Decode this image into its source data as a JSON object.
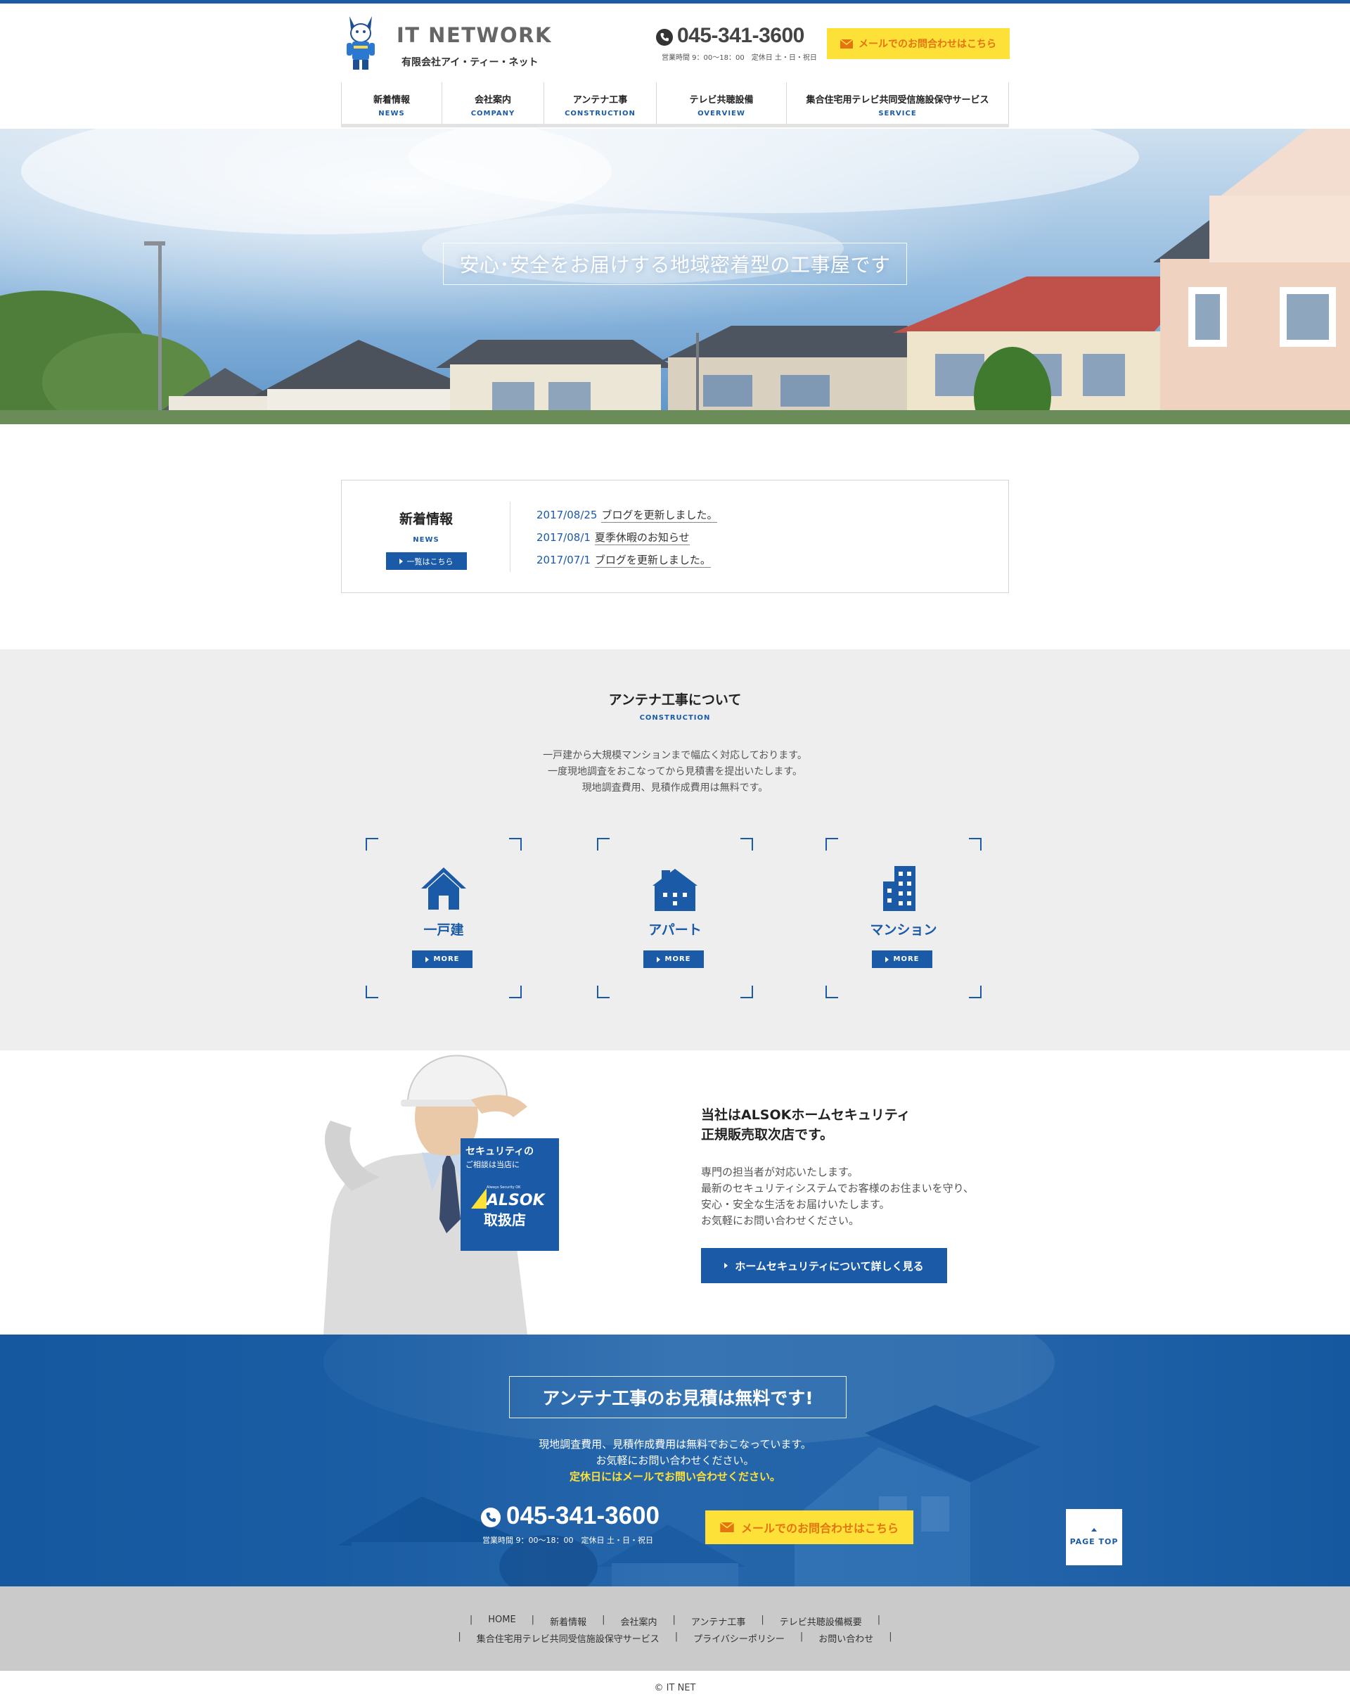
{
  "header": {
    "logo_title": "IT NETWORK",
    "logo_sub": "有限会社アイ・ティー・ネット",
    "tel": "045-341-3600",
    "hours": "営業時間 9：00〜18：00　定休日 土・日・祝日",
    "mail_label": "メールでのお問合わせはこちら"
  },
  "nav": [
    {
      "ja": "新着情報",
      "en": "NEWS"
    },
    {
      "ja": "会社案内",
      "en": "COMPANY"
    },
    {
      "ja": "アンテナ工事",
      "en": "CONSTRUCTION"
    },
    {
      "ja": "テレビ共聴設備",
      "en": "OVERVIEW"
    },
    {
      "ja": "集合住宅用テレビ共同受信施設保守サービス",
      "en": "SERVICE"
    }
  ],
  "hero": {
    "caption": "安心･安全をお届けする地域密着型の工事屋です"
  },
  "news": {
    "title": "新着情報",
    "en": "NEWS",
    "list_button": "一覧はこちら",
    "items": [
      {
        "date": "2017/08/25",
        "text": "ブログを更新しました。"
      },
      {
        "date": "2017/08/1",
        "text": "夏季休暇のお知らせ"
      },
      {
        "date": "2017/07/1",
        "text": "ブログを更新しました。"
      }
    ]
  },
  "construction": {
    "title": "アンテナ工事について",
    "en": "CONSTRUCTION",
    "desc": [
      "一戸建から大規模マンションまで幅広く対応しております。",
      "一度現地調査をおこなってから見積書を提出いたします。",
      "現地調査費用、見積作成費用は無料です。"
    ],
    "cards": [
      {
        "label": "一戸建",
        "icon": "house-icon",
        "more": "MORE"
      },
      {
        "label": "アパート",
        "icon": "apartment-icon",
        "more": "MORE"
      },
      {
        "label": "マンション",
        "icon": "building-icon",
        "more": "MORE"
      }
    ]
  },
  "alsok": {
    "title_line1": "当社はALSOKホームセキュリティ",
    "title_line2": "正規販売取次店です。",
    "text": [
      "専門の担当者が対応いたします。",
      "最新のセキュリティシステムでお客様のお住まいを守り、",
      "安心・安全な生活をお届けいたします。",
      "お気軽にお問い合わせください。"
    ],
    "button": "ホームセキュリティについて詳しく見る",
    "badge_line1": "セキュリティの",
    "badge_line2": "ご相談は当店に",
    "badge_brand_small": "Always Security OK",
    "badge_brand": "ALSOK",
    "badge_shop": "取扱店"
  },
  "cta": {
    "title": "アンテナ工事のお見積は無料です!",
    "line1": "現地調査費用、見積作成費用は無料でおこなっています。",
    "line2": "お気軽にお問い合わせください。",
    "line3": "定休日にはメールでお問い合わせください。",
    "tel": "045-341-3600",
    "hours": "営業時間 9：00〜18：00　定休日 土・日・祝日",
    "mail_label": "メールでのお問合わせはこちら",
    "page_top": "PAGE TOP"
  },
  "footer": {
    "row1": [
      "HOME",
      "新着情報",
      "会社案内",
      "アンテナ工事",
      "テレビ共聴設備概要"
    ],
    "row2": [
      "集合住宅用テレビ共同受信施設保守サービス",
      "プライバシーポリシー",
      "お問い合わせ"
    ],
    "copyright": "© IT NET"
  },
  "colors": {
    "brand_blue": "#1a5aa6",
    "cta_yellow": "#fde138",
    "mail_text": "#e47411"
  }
}
